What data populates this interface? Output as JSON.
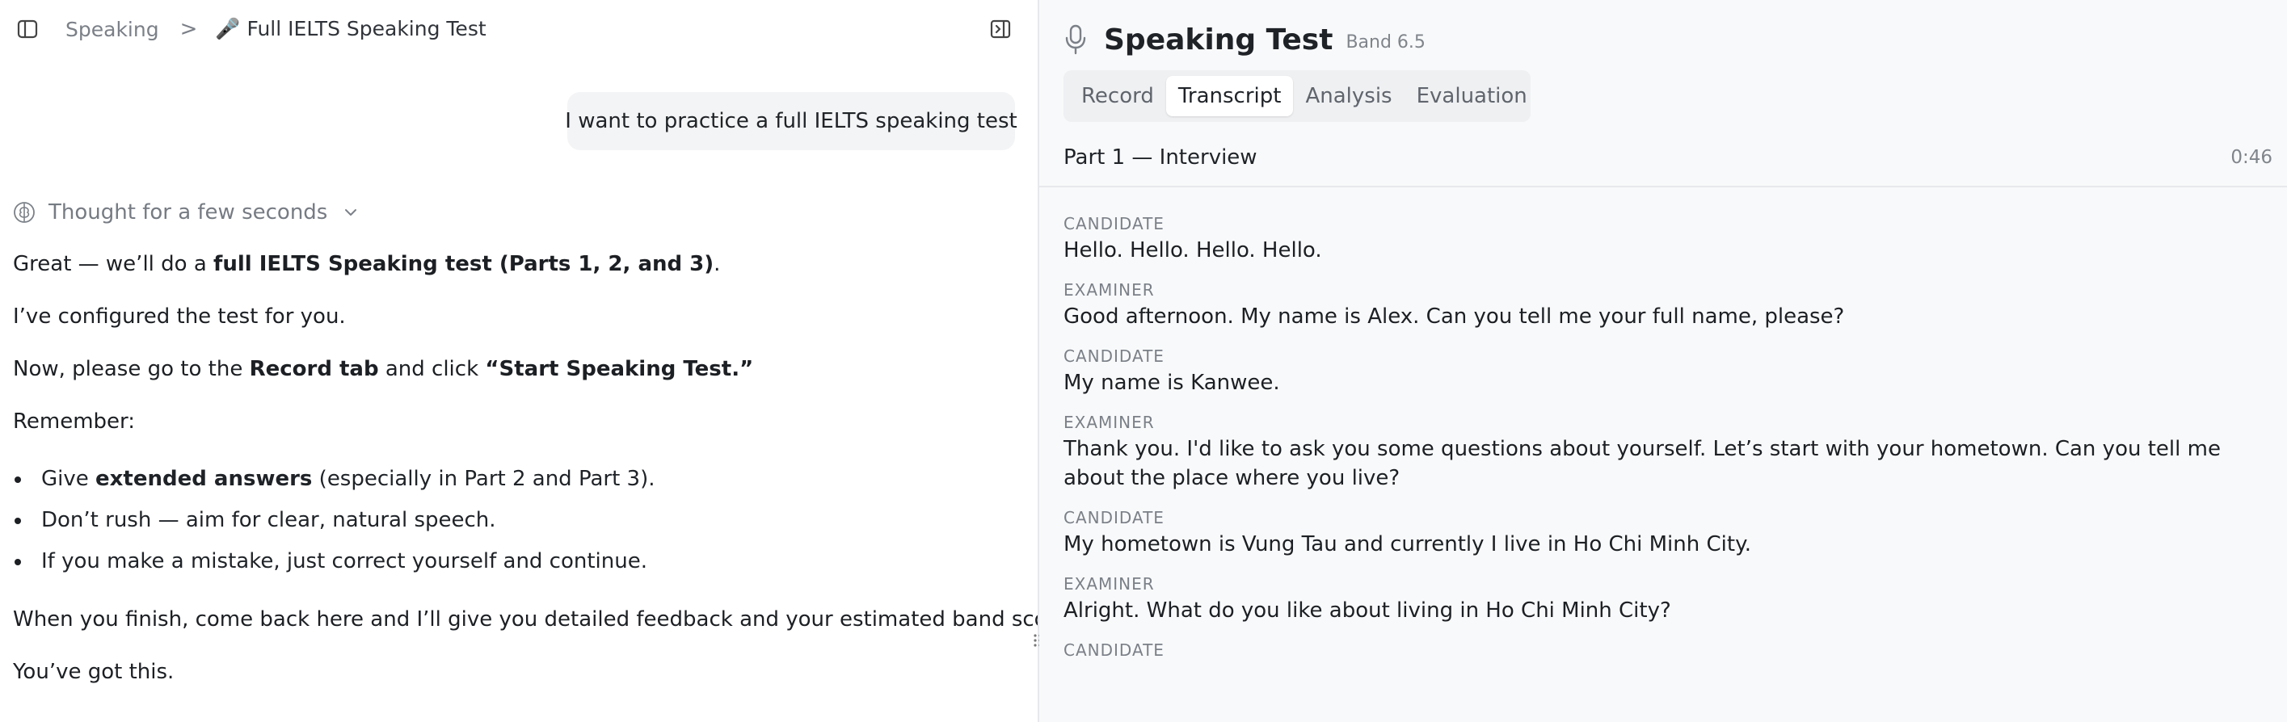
{
  "breadcrumb": {
    "root": "Speaking",
    "separator": ">",
    "current": "🎤 Full IELTS Speaking Test"
  },
  "chat": {
    "user_message": "I want to practice a full IELTS speaking test",
    "thought_label": "Thought for a few seconds",
    "intro": {
      "before": "Great — we’ll do a ",
      "bold": "full IELTS Speaking test (Parts 1, 2, and 3)",
      "after": "."
    },
    "configured": "I’ve configured the test for you.",
    "instruction": {
      "before": "Now, please go to the ",
      "bold1": "Record tab",
      "middle": " and click ",
      "bold2": "“Start Speaking Test.”"
    },
    "remember": "Remember:",
    "tips": [
      {
        "before": "Give ",
        "bold": "extended answers",
        "after": " (especially in Part 2 and Part 3)."
      },
      {
        "before": "Don’t rush — aim for clear, natural speech.",
        "bold": "",
        "after": ""
      },
      {
        "before": "If you make a mistake, just correct yourself and continue.",
        "bold": "",
        "after": ""
      }
    ],
    "finish": "When you finish, come back here and I’ll give you detailed feedback and your estimated band score.",
    "closing": "You’ve got this."
  },
  "panel": {
    "title": "Speaking Test",
    "band": "Band 6.5",
    "tabs": [
      {
        "label": "Record"
      },
      {
        "label": "Transcript"
      },
      {
        "label": "Analysis"
      },
      {
        "label": "Evaluation"
      }
    ],
    "active_tab": "Transcript",
    "part_title": "Part 1 — Interview",
    "part_time": "0:46",
    "transcript": [
      {
        "speaker": "CANDIDATE",
        "text": "Hello. Hello. Hello. Hello."
      },
      {
        "speaker": "EXAMINER",
        "text": "Good afternoon. My name is Alex. Can you tell me your full name, please?"
      },
      {
        "speaker": "CANDIDATE",
        "text": "My name is Kanwee."
      },
      {
        "speaker": "EXAMINER",
        "text": "Thank you. I'd like to ask you some questions about yourself. Let’s start with your hometown. Can you tell me about the place where you live?"
      },
      {
        "speaker": "CANDIDATE",
        "text": "My hometown is Vung Tau and currently I live in Ho Chi Minh City."
      },
      {
        "speaker": "EXAMINER",
        "text": "Alright. What do you like about living in Ho Chi Minh City?"
      },
      {
        "speaker": "CANDIDATE",
        "text": ""
      }
    ]
  },
  "icons": {
    "sidebar_toggle": "sidebar-toggle-icon",
    "panel_toggle": "panel-toggle-icon",
    "thought": "brain-icon",
    "expand": "chevron-down-icon",
    "mic": "microphone-icon",
    "drag": "drag-handle-icon"
  }
}
